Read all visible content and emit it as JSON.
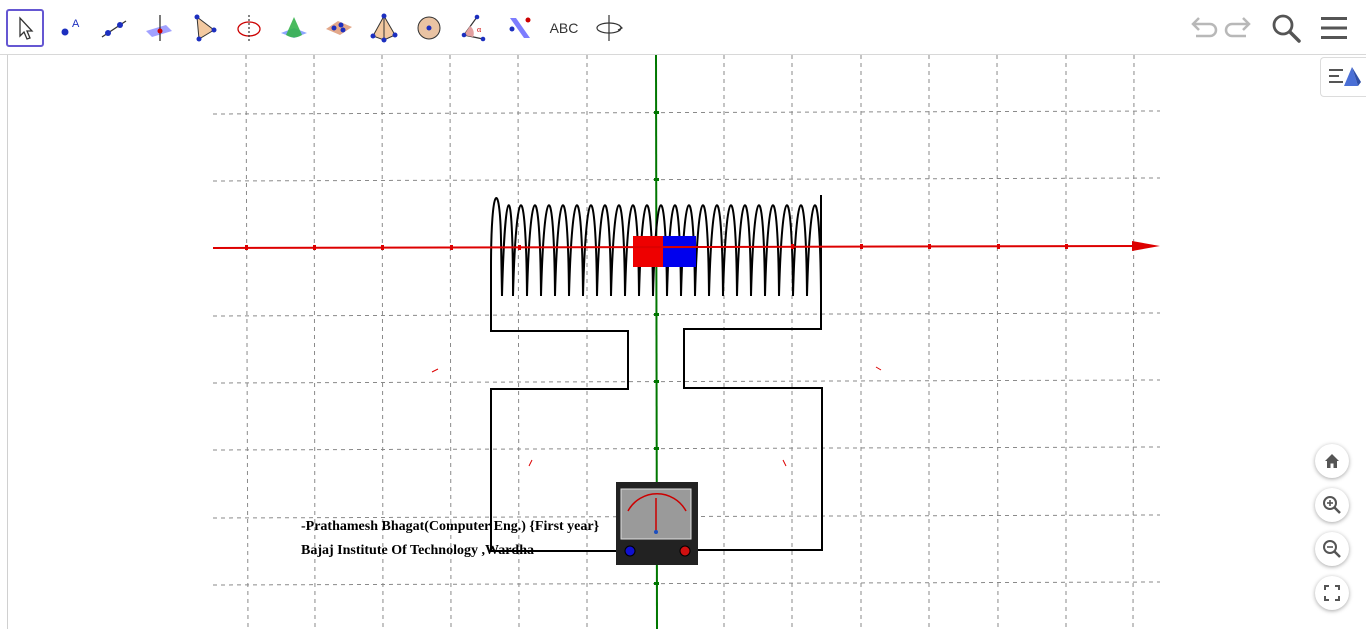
{
  "toolbar": {
    "tools": [
      {
        "name": "move-tool",
        "icon": "cursor-arrow-icon",
        "active": true
      },
      {
        "name": "point-tool",
        "icon": "point-icon",
        "label": "A"
      },
      {
        "name": "line-tool",
        "icon": "line-icon"
      },
      {
        "name": "perpendicular-line-tool",
        "icon": "perpendicular-plane-icon"
      },
      {
        "name": "polygon-tool",
        "icon": "triangle-icon"
      },
      {
        "name": "circle-axis-tool",
        "icon": "circle-axis-icon"
      },
      {
        "name": "intersect-surfaces-tool",
        "icon": "cone-icon"
      },
      {
        "name": "plane-tool",
        "icon": "plane-points-icon"
      },
      {
        "name": "pyramid-tool",
        "icon": "pyramid-icon"
      },
      {
        "name": "sphere-tool",
        "icon": "sphere-icon"
      },
      {
        "name": "angle-tool",
        "icon": "angle-icon",
        "label": "α"
      },
      {
        "name": "reflect-tool",
        "icon": "reflect-plane-icon"
      },
      {
        "name": "text-tool",
        "icon": "text-icon",
        "label": "ABC"
      },
      {
        "name": "rotate-view-tool",
        "icon": "rotate-view-icon"
      }
    ],
    "undo_icon": "undo-icon",
    "redo_icon": "redo-icon",
    "search_icon": "search-icon",
    "menu_icon": "menu-icon"
  },
  "credits": {
    "line1": "-Prathamesh Bhagat(Computer Eng.) {First year}",
    "line2": "Bajaj Institute Of Technology ,Wardha"
  },
  "view_controls": {
    "style_bar_icon": "style-bar-toggle-icon",
    "home_icon": "home-icon",
    "zoom_in_icon": "zoom-in-icon",
    "zoom_out_icon": "zoom-out-icon",
    "fullscreen_icon": "fullscreen-icon"
  },
  "colors": {
    "accent": "#6557d2",
    "x_axis": "#dd0000",
    "z_axis": "#007700",
    "magnet_north": "#ee0000",
    "magnet_south": "#0000ee",
    "wire": "#000000",
    "meter_body": "#222222",
    "meter_face": "#9a9a9a"
  }
}
